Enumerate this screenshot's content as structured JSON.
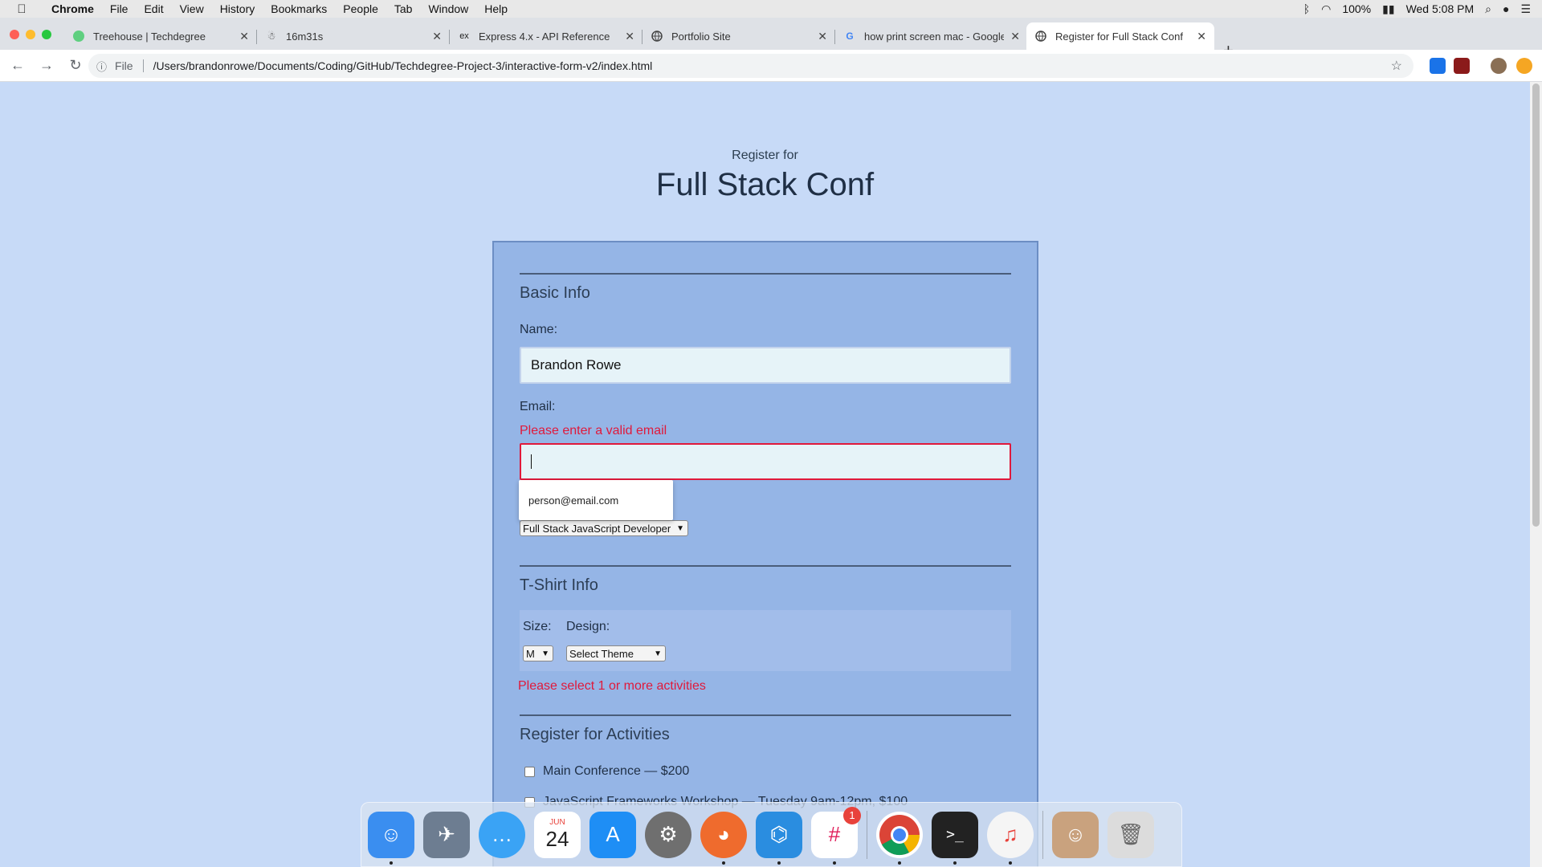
{
  "menubar": {
    "app": "Chrome",
    "items": [
      "File",
      "Edit",
      "View",
      "History",
      "Bookmarks",
      "People",
      "Tab",
      "Window",
      "Help"
    ],
    "battery": "100%",
    "clock": "Wed 5:08 PM"
  },
  "tabs": [
    {
      "title": "Treehouse | Techdegree",
      "icon": "treehouse-icon"
    },
    {
      "title": "16m31s",
      "icon": "figma-icon"
    },
    {
      "title": "Express 4.x - API Reference",
      "icon": "express-icon",
      "icon_text": "ex"
    },
    {
      "title": "Portfolio Site",
      "icon": "globe-icon"
    },
    {
      "title": "how print screen mac - Google",
      "icon": "google-icon"
    },
    {
      "title": "Register for Full Stack Conf",
      "icon": "globe-icon"
    }
  ],
  "toolbar": {
    "scheme": "File",
    "url": "/Users/brandonrowe/Documents/Coding/GitHub/Techdegree-Project-3/interactive-form-v2/index.html"
  },
  "page": {
    "pre_title": "Register for",
    "title": "Full Stack Conf",
    "basic_info": {
      "legend": "Basic Info",
      "name_label": "Name:",
      "name_value": "Brandon Rowe",
      "email_label": "Email:",
      "email_error": "Please enter a valid email",
      "email_value": "",
      "email_suggestion": "person@email.com",
      "job_role_value": "Full Stack JavaScript Developer"
    },
    "tshirt": {
      "legend": "T-Shirt Info",
      "size_label": "Size:",
      "size_value": "M",
      "design_label": "Design:",
      "design_value": "Select Theme"
    },
    "activities": {
      "error": "Please select 1 or more activities",
      "legend": "Register for Activities",
      "items": [
        "Main Conference — $200",
        "JavaScript Frameworks Workshop — Tuesday 9am-12pm, $100"
      ]
    }
  },
  "dock": {
    "apps": [
      {
        "name": "finder-icon",
        "color": "#3a8ef0"
      },
      {
        "name": "launchpad-icon",
        "color": "#6d7d91"
      },
      {
        "name": "messages-icon",
        "color": "#3aa3f5"
      },
      {
        "name": "calendar-icon",
        "color": "#ffffff",
        "month": "JUN",
        "day": "24"
      },
      {
        "name": "app-store-icon",
        "color": "#1e8ef5"
      },
      {
        "name": "system-preferences-icon",
        "color": "#6f6f6f"
      },
      {
        "name": "firefox-icon",
        "color": "#ef6b2d"
      },
      {
        "name": "vscode-icon",
        "color": "#2a8de0"
      },
      {
        "name": "slack-icon",
        "color": "#ffffff",
        "badge": "1"
      },
      {
        "name": "chrome-icon",
        "color": "#ffffff"
      },
      {
        "name": "terminal-icon",
        "color": "#222222"
      },
      {
        "name": "itunes-icon",
        "color": "#f5f5f5"
      },
      {
        "name": "user-photo-icon",
        "color": "#c9a27e"
      },
      {
        "name": "trash-icon",
        "color": "#dcdcdc"
      }
    ]
  }
}
